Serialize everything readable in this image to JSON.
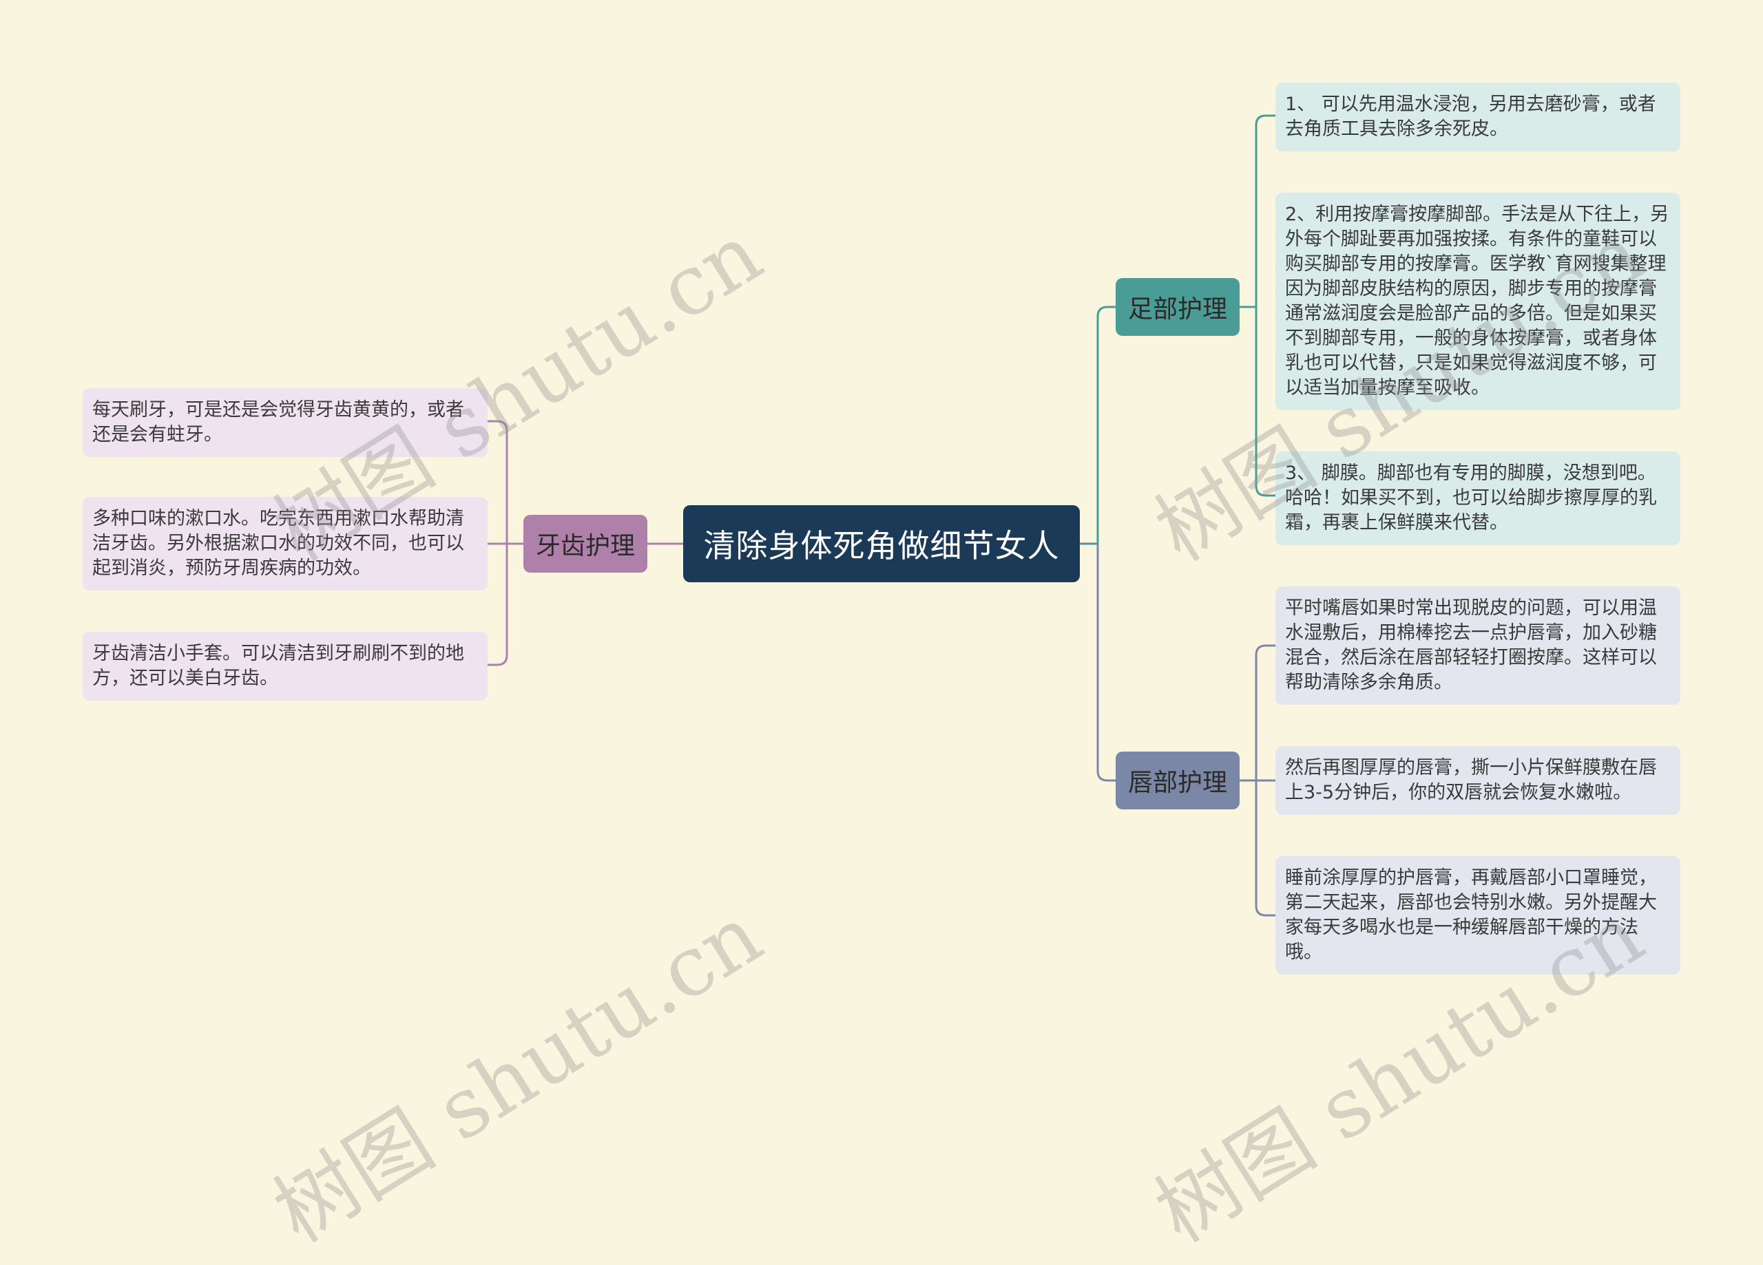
{
  "root": {
    "label": "清除身体死角做细节女人"
  },
  "branches": {
    "teeth": {
      "label": "牙齿护理",
      "color": "#ae80aa",
      "leaf_bg": "#efe3ef",
      "leaves": [
        "每天刷牙，可是还是会觉得牙齿黄黄的，或者还是会有蛀牙。",
        "多种口味的漱口水。吃完东西用漱口水帮助清洁牙齿。另外根据漱口水的功效不同，也可以起到消炎，预防牙周疾病的功效。",
        "牙齿清洁小手套。可以清洁到牙刷刷不到的地方，还可以美白牙齿。"
      ]
    },
    "foot": {
      "label": "足部护理",
      "color": "#4a9d96",
      "leaf_bg": "#d9ecea",
      "leaves": [
        "1、 可以先用温水浸泡，另用去磨砂膏，或者去角质工具去除多余死皮。",
        "2、利用按摩膏按摩脚部。手法是从下往上，另外每个脚趾要再加强按揉。有条件的童鞋可以购买脚部专用的按摩膏。医学教`育网搜集整理因为脚部皮肤结构的原因，脚步专用的按摩膏通常滋润度会是脸部产品的多倍。但是如果买不到脚部专用，一般的身体按摩膏，或者身体乳也可以代替，只是如果觉得滋润度不够，可以适当加量按摩至吸收。",
        "3、 脚膜。脚部也有专用的脚膜，没想到吧。哈哈！如果买不到，也可以给脚步擦厚厚的乳霜，再裹上保鲜膜来代替。"
      ]
    },
    "lips": {
      "label": "唇部护理",
      "color": "#7a87a6",
      "leaf_bg": "#e3e6ee",
      "leaves": [
        "平时嘴唇如果时常出现脱皮的问题，可以用温水湿敷后，用棉棒挖去一点护唇膏，加入砂糖混合，然后涂在唇部轻轻打圈按摩。这样可以帮助清除多余角质。",
        "然后再图厚厚的唇膏，撕一小片保鲜膜敷在唇上3-5分钟后，你的双唇就会恢复水嫩啦。",
        "睡前涂厚厚的护唇膏，再戴唇部小口罩睡觉，第二天起来，唇部也会特别水嫩。另外提醒大家每天多喝水也是一种缓解唇部干燥的方法哦。"
      ]
    }
  },
  "watermark": {
    "text": "树图 shutu.cn"
  },
  "colors": {
    "background": "#faf5de",
    "root": "#1a3a57"
  }
}
